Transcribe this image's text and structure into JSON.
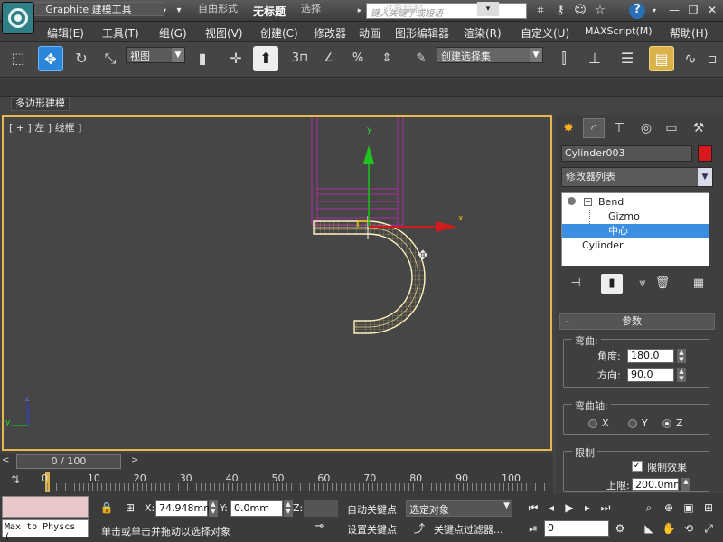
{
  "title_bar": {
    "title": "无标题",
    "search_placeholder": "键入关键字或短语",
    "help_label": "?"
  },
  "menu": {
    "items": [
      "编辑(E)",
      "工具(T)",
      "组(G)",
      "视图(V)",
      "创建(C)",
      "修改器",
      "动画",
      "图形编辑器",
      "渲染(R)",
      "自定义(U)",
      "MAXScript(M)",
      "帮助(H)"
    ]
  },
  "toolbar": {
    "ref_coord": "视图",
    "selection_set": "创建选择集",
    "snap_label": "3"
  },
  "ribbon": {
    "tabs": [
      "Graphite 建模工具",
      "自由形式",
      "选择",
      "对象绘制"
    ],
    "active_subtab": "多边形建模"
  },
  "viewport": {
    "label": "[ + ] 左 ] 线框 ]",
    "gizmo_y": "y",
    "gizmo_x": "x",
    "corner_z": "z",
    "corner_y": "y"
  },
  "command_panel": {
    "object_name": "Cylinder003",
    "object_color": "#d8181c",
    "modifier_list": "修改器列表",
    "stack": [
      {
        "label": "Bend",
        "level": 0
      },
      {
        "label": "Gizmo",
        "level": 1
      },
      {
        "label": "中心",
        "level": 1,
        "selected": true
      },
      {
        "label": "Cylinder",
        "level": 0
      }
    ],
    "rollout_title": "参数",
    "bend": {
      "group": "弯曲:",
      "angle_label": "角度:",
      "angle_value": "180.0",
      "direction_label": "方向:",
      "direction_value": "90.0"
    },
    "axis": {
      "group": "弯曲轴:",
      "options": [
        "X",
        "Y",
        "Z"
      ],
      "selected": "Z"
    },
    "limits": {
      "group": "限制",
      "limit_effect_label": "限制效果",
      "limit_effect_checked": true,
      "upper_label": "上限:",
      "upper_value": "200.0mm"
    }
  },
  "timeline": {
    "frame_display": "0 / 100",
    "ticks": [
      "0",
      "10",
      "20",
      "30",
      "40",
      "50",
      "60",
      "70",
      "80",
      "90",
      "100"
    ]
  },
  "status": {
    "maxscript_text": "Max to Physcs (",
    "x_label": "X:",
    "x_value": "74.948mm",
    "y_label": "Y:",
    "y_value": "0.0mm",
    "z_label": "Z:",
    "autokey_label": "自动关键点",
    "selected_object": "选定对象",
    "setkey_label": "设置关键点",
    "key_filters_label": "关键点过滤器...",
    "frame_value": "0",
    "prompt": "单击或单击并拖动以选择对象"
  }
}
